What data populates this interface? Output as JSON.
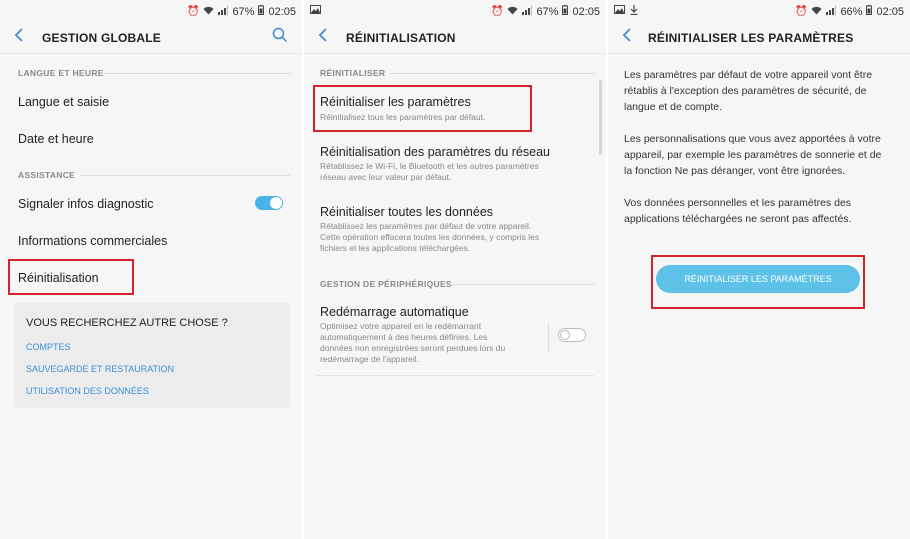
{
  "accent_color": "#3c8fd6",
  "highlight_color": "#d5232c",
  "screen1": {
    "status": {
      "battery": "67%",
      "time": "02:05"
    },
    "title": "GESTION GLOBALE",
    "section_langue": "LANGUE ET HEURE",
    "item_langue": "Langue et saisie",
    "item_date": "Date et heure",
    "section_assistance": "ASSISTANCE",
    "item_diagnostic": "Signaler infos diagnostic",
    "diagnostic_toggle": "on",
    "item_commercial": "Informations commerciales",
    "item_reinit": "Réinitialisation",
    "card": {
      "title": "VOUS RECHERCHEZ AUTRE CHOSE ?",
      "links": [
        "COMPTES",
        "SAUVEGARDE ET RESTAURATION",
        "UTILISATION DES DONNÉES"
      ]
    }
  },
  "screen2": {
    "status": {
      "battery": "67%",
      "time": "02:05"
    },
    "title": "RÉINITIALISATION",
    "section_reinit": "RÉINITIALISER",
    "item1_title": "Réinitialiser les paramètres",
    "item1_sub": "Réinitialisez tous les paramètres par défaut.",
    "item2_title": "Réinitialisation des paramètres du réseau",
    "item2_sub1": "Rétablissez le Wi-Fi, le Bluetooth et les autres paramètres",
    "item2_sub2": "réseau avec leur valeur par défaut.",
    "item3_title": "Réinitialiser toutes les données",
    "item3_sub1": "Rétablissez les paramètres par défaut de votre appareil.",
    "item3_sub2": "Cette opération effacera toutes les données, y compris les",
    "item3_sub3": "fichiers et les applications téléchargées.",
    "section_gestion": "GESTION DE PÉRIPHÉRIQUES",
    "item4_title": "Redémarrage automatique",
    "item4_sub1": "Optimisez votre appareil en le redémarrant",
    "item4_sub2": "automatiquement à des heures définies. Les",
    "item4_sub3": "données non enregistrées seront perdues lors du",
    "item4_sub4": "redémarrage de l'appareil.",
    "restart_toggle": "off"
  },
  "screen3": {
    "status": {
      "battery": "66%",
      "time": "02:05"
    },
    "title": "RÉINITIALISER LES PARAMÈTRES",
    "para1_l1": "Les paramètres par défaut de votre appareil vont être",
    "para1_l2": "rétablis à l'exception des paramètres de sécurité, de",
    "para1_l3": "langue et de compte.",
    "para2_l1": "Les personnalisations que vous avez apportées à votre",
    "para2_l2": "appareil, par exemple les paramètres de sonnerie et de",
    "para2_l3": "la fonction Ne pas déranger, vont être ignorées.",
    "para3_l1": "Vos données personnelles et les paramètres des",
    "para3_l2": "applications téléchargées ne seront pas affectés.",
    "button": "RÉINITIALISER LES PARAMÈTRES"
  }
}
